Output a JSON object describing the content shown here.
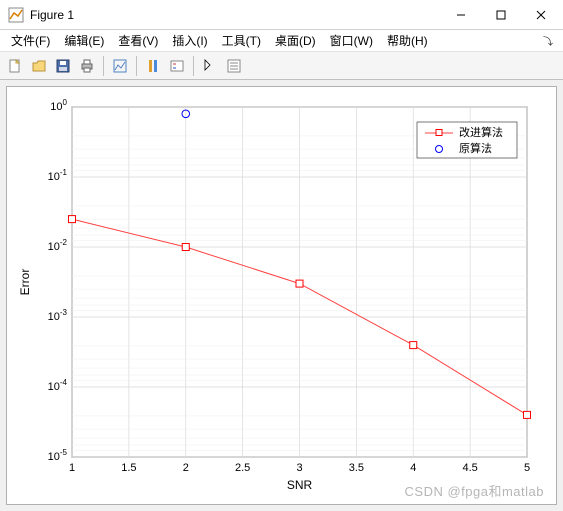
{
  "window": {
    "title": "Figure 1"
  },
  "menu": {
    "file": "文件(F)",
    "edit": "编辑(E)",
    "view": "查看(V)",
    "insert": "插入(I)",
    "tools": "工具(T)",
    "desktop": "桌面(D)",
    "window_m": "窗口(W)",
    "help": "帮助(H)"
  },
  "legend": {
    "series1": "改进算法",
    "series2": "原算法"
  },
  "axes": {
    "xlabel": "SNR",
    "ylabel": "Error"
  },
  "xticks": [
    "1",
    "1.5",
    "2",
    "2.5",
    "3",
    "3.5",
    "4",
    "4.5",
    "5"
  ],
  "yticks": [
    "10^{-5}",
    "10^{-4}",
    "10^{-3}",
    "10^{-2}",
    "10^{-1}",
    "10^{0}"
  ],
  "watermark": "CSDN @fpga和matlab",
  "chart_data": {
    "type": "line",
    "xlabel": "SNR",
    "ylabel": "Error",
    "xlim": [
      1,
      5
    ],
    "ylim": [
      1e-05,
      1
    ],
    "yscale": "log",
    "grid": true,
    "legend_position": "upper-right",
    "series": [
      {
        "name": "改进算法",
        "marker": "square",
        "color": "#ff0000",
        "x": [
          1,
          2,
          3,
          4,
          5
        ],
        "y": [
          0.025,
          0.01,
          0.003,
          0.0004,
          4e-05
        ]
      },
      {
        "name": "原算法",
        "marker": "circle",
        "color": "#0000ff",
        "x": [
          2
        ],
        "y": [
          0.8
        ]
      }
    ]
  }
}
